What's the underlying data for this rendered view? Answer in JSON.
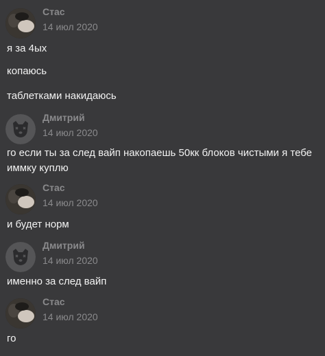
{
  "messages": [
    {
      "author": "Стас",
      "date": "14 июл 2020",
      "avatar": "user-photo",
      "lines": [
        "я за 4ых",
        "копаюсь",
        "таблетками накидаюсь"
      ]
    },
    {
      "author": "Дмитрий",
      "date": "14 июл 2020",
      "avatar": "deactivated-dog-icon",
      "lines": [
        "го если ты за след вайп накопаешь 50кк блоков чистыми я тебе иммку куплю"
      ]
    },
    {
      "author": "Стас",
      "date": "14 июл 2020",
      "avatar": "user-photo",
      "lines": [
        "и будет норм"
      ]
    },
    {
      "author": "Дмитрий",
      "date": "14 июл 2020",
      "avatar": "deactivated-dog-icon",
      "lines": [
        "именно за след вайп"
      ]
    },
    {
      "author": "Стас",
      "date": "14 июл 2020",
      "avatar": "user-photo",
      "lines": [
        "го"
      ]
    }
  ],
  "colors": {
    "background": "#39393b",
    "author": "#8a8a8c",
    "text": "#f3f3f3"
  }
}
